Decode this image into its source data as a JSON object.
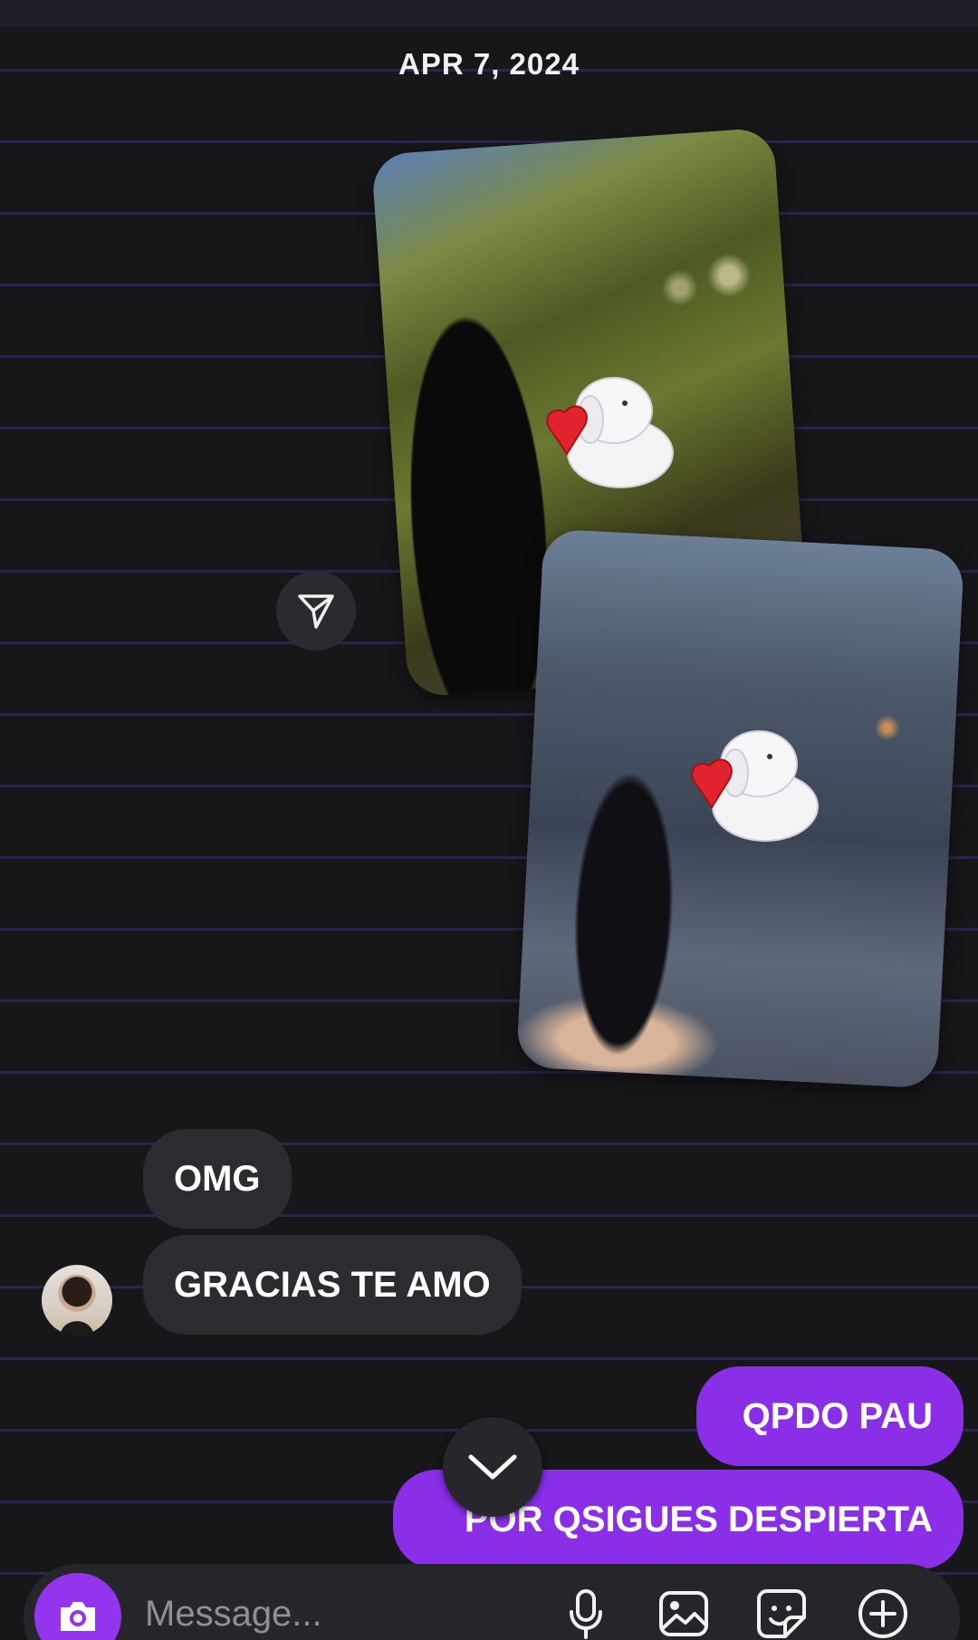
{
  "chat": {
    "date_label": "APR 7, 2024",
    "messages": {
      "incoming": [
        "OMG",
        "GRACIAS TE AMO"
      ],
      "outgoing": [
        "QPDO PAU",
        "POR QSIGUES DESPIERTA"
      ]
    }
  },
  "composer": {
    "placeholder": "Message..."
  },
  "colors": {
    "background": "#17171a",
    "stripe": "#2a2450",
    "incoming_bubble": "#2c2c30",
    "outgoing_bubble": "#8a2ee8",
    "camera_button": "#9434ee"
  },
  "icons": [
    "share-icon",
    "chevron-down-icon",
    "camera-icon",
    "microphone-icon",
    "gallery-icon",
    "sticker-icon",
    "plus-icon"
  ]
}
